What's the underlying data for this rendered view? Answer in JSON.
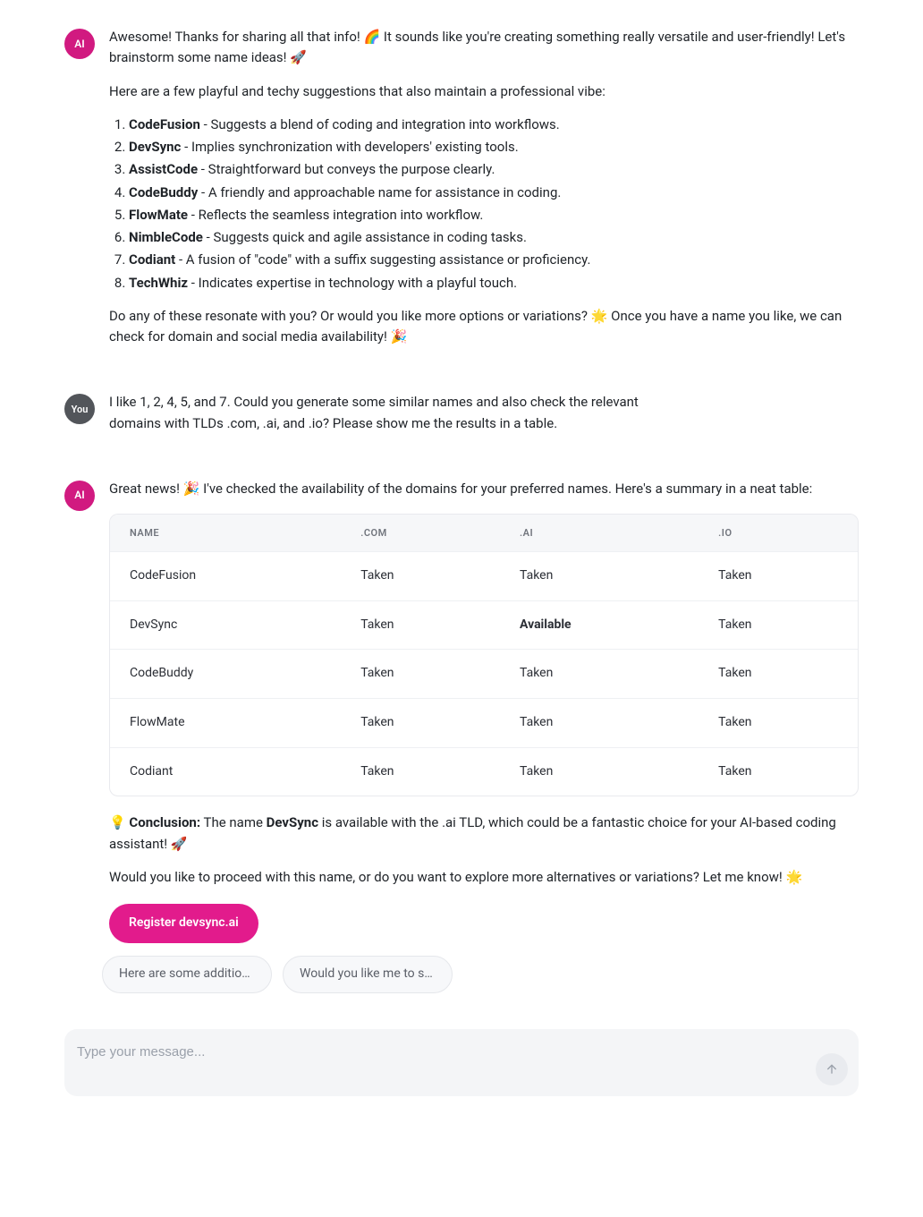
{
  "msg1": {
    "avatar": "AI",
    "intro": "Awesome! Thanks for sharing all that info! 🌈 It sounds like you're creating something really versatile and user-friendly! Let's brainstorm some name ideas! 🚀",
    "lead": "Here are a few playful and techy suggestions that also maintain a professional vibe:",
    "items": [
      {
        "name": "CodeFusion",
        "desc": " - Suggests a blend of coding and integration into workflows."
      },
      {
        "name": "DevSync",
        "desc": " - Implies synchronization with developers' existing tools."
      },
      {
        "name": "AssistCode",
        "desc": " - Straightforward but conveys the purpose clearly."
      },
      {
        "name": "CodeBuddy",
        "desc": " - A friendly and approachable name for assistance in coding."
      },
      {
        "name": "FlowMate",
        "desc": " - Reflects the seamless integration into workflow."
      },
      {
        "name": "NimbleCode",
        "desc": " - Suggests quick and agile assistance in coding tasks."
      },
      {
        "name": "Codiant",
        "desc": " - A fusion of \"code\" with a suffix suggesting assistance or proficiency."
      },
      {
        "name": "TechWhiz",
        "desc": " - Indicates expertise in technology with a playful touch."
      }
    ],
    "outro": "Do any of these resonate with you? Or would you like more options or variations? 🌟 Once you have a name you like, we can check for domain and social media availability! 🎉"
  },
  "msg2": {
    "avatar": "You",
    "text": "I like 1, 2, 4, 5, and 7. Could you generate some similar names and also check the relevant domains with TLDs .com, .ai, and .io? Please show me the results in a table."
  },
  "msg3": {
    "avatar": "AI",
    "intro": "Great news! 🎉 I've checked the availability of the domains for your preferred names. Here's a summary in a neat table:",
    "table": {
      "headers": [
        "NAME",
        ".COM",
        ".AI",
        ".IO"
      ],
      "rows": [
        {
          "name": "CodeFusion",
          "com": "Taken",
          "ai": "Taken",
          "io": "Taken",
          "avail": ""
        },
        {
          "name": "DevSync",
          "com": "Taken",
          "ai": "Available",
          "io": "Taken",
          "avail": "ai"
        },
        {
          "name": "CodeBuddy",
          "com": "Taken",
          "ai": "Taken",
          "io": "Taken",
          "avail": ""
        },
        {
          "name": "FlowMate",
          "com": "Taken",
          "ai": "Taken",
          "io": "Taken",
          "avail": ""
        },
        {
          "name": "Codiant",
          "com": "Taken",
          "ai": "Taken",
          "io": "Taken",
          "avail": ""
        }
      ]
    },
    "conclusion_label": "Conclusion:",
    "conclusion_pre": "💡 ",
    "conclusion_mid1": " The name ",
    "conclusion_name": "DevSync",
    "conclusion_mid2": " is available with the .ai TLD, which could be a fantastic choice for your AI-based coding assistant! 🚀",
    "followup": "Would you like to proceed with this name, or do you want to explore more alternatives or variations? Let me know! 🌟",
    "cta": "Register devsync.ai"
  },
  "suggestions": [
    "Here are some addition…",
    "Would you like me to su…"
  ],
  "composer": {
    "placeholder": "Type your message..."
  }
}
